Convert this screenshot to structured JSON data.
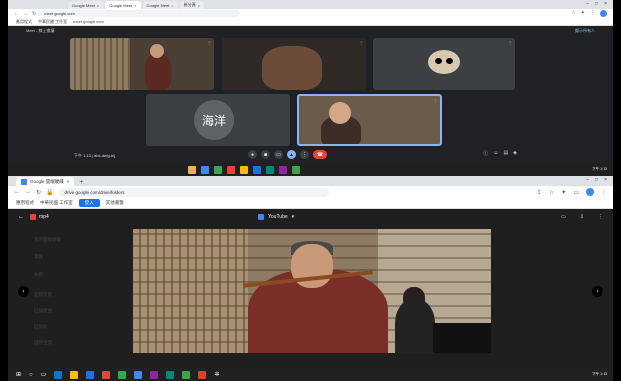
{
  "top": {
    "tabs": [
      "Google Meet",
      "Google Meet",
      "Google Meet",
      "新分頁"
    ],
    "url": "meet.google.com",
    "bookmarks": [
      "應用程式",
      "中華民國 工作室",
      "meet.google.com"
    ],
    "meet_header_left": "Meet - 線上會議",
    "meet_header_right": "顯示所有人",
    "tiles": [
      {
        "name": "",
        "label": ""
      },
      {
        "name": "",
        "label": ""
      },
      {
        "name": "",
        "label": ""
      },
      {
        "name": "海洋",
        "label": ""
      },
      {
        "name": "",
        "label": ""
      }
    ],
    "meeting_code": "下午 1:13 | abc-defg-hij",
    "taskbar_time": "下午 1:13"
  },
  "bottom": {
    "tab_title": "Google 雲端硬碟",
    "url": "drive.google.com/drive/folders",
    "bookmarks": [
      "應用程式",
      "中華民國 工作室"
    ],
    "bookmark_chip": "登入",
    "bookmark_extra": "其他書籤",
    "file_name": "mp4",
    "center_title": "YouTube",
    "sidebar_ghosts": [
      "我的雲端硬碟",
      "電腦",
      "共用",
      "近期存取",
      "已加星號",
      "垃圾桶",
      "儲存空間"
    ],
    "taskbar_time": "下午 1:13"
  },
  "colors": {
    "meet_bg": "#202124",
    "accent": "#8ab4f8",
    "end_call": "#ea4335",
    "drive_dark": "#1f1f1f"
  }
}
